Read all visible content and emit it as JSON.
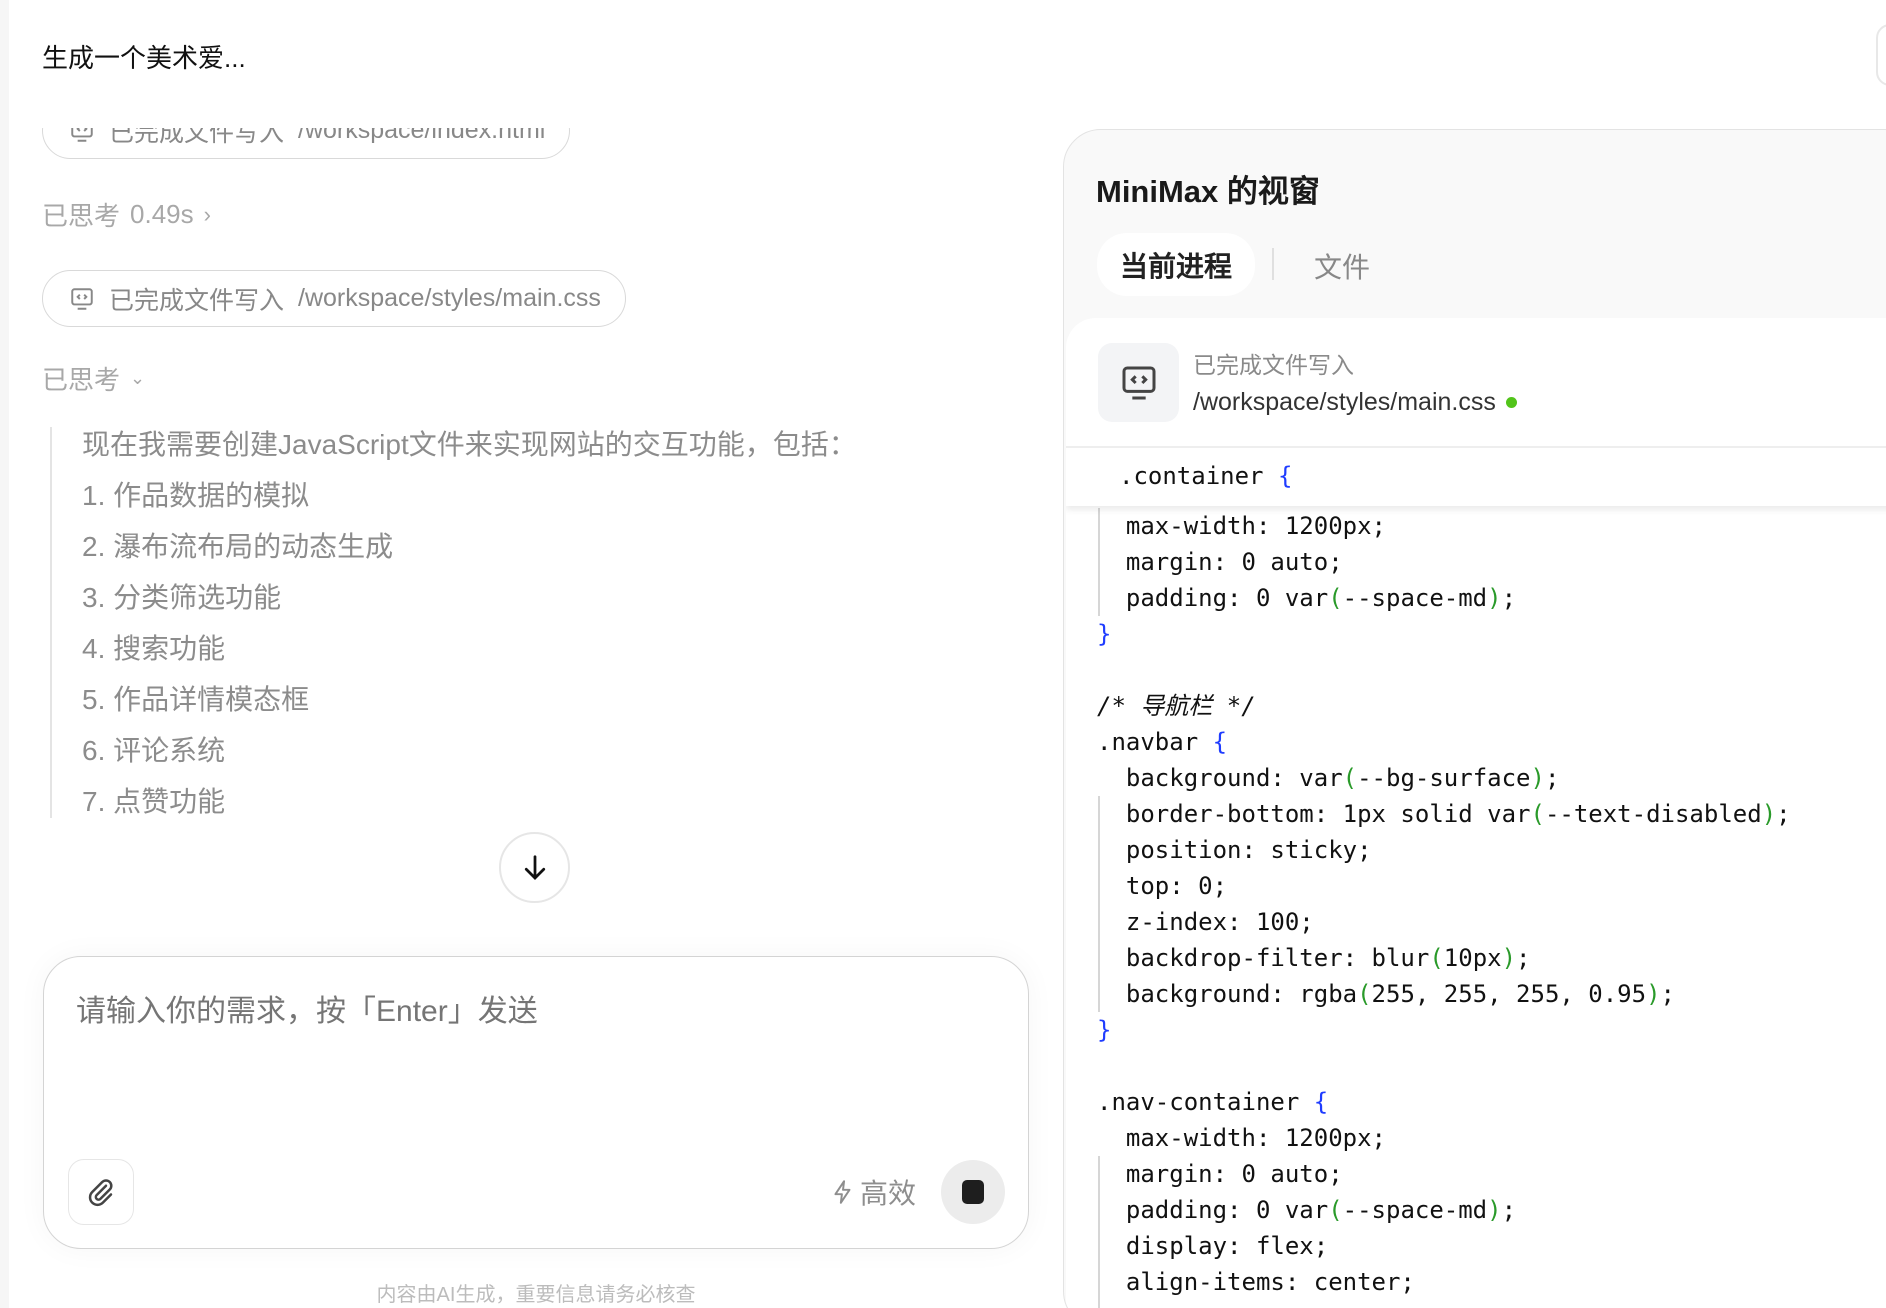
{
  "header": {
    "title": "生成一个美术爱..."
  },
  "chat": {
    "chip1": {
      "label": "已完成文件写入",
      "path": "/workspace/index.html"
    },
    "think1": {
      "label": "已思考",
      "time": "0.49s"
    },
    "chip2": {
      "label": "已完成文件写入",
      "path": "/workspace/styles/main.css"
    },
    "think2": {
      "label": "已思考"
    },
    "thought_lines": [
      "现在我需要创建JavaScript文件来实现网站的交互功能，包括：",
      "1. 作品数据的模拟",
      "2. 瀑布流布局的动态生成",
      "3. 分类筛选功能",
      "4. 搜索功能",
      "5. 作品详情模态框",
      "6. 评论系统",
      "7. 点赞功能"
    ]
  },
  "input": {
    "placeholder": "请输入你的需求，按「Enter」发送",
    "mode_label": "高效"
  },
  "footer": {
    "disclaimer": "内容由AI生成，重要信息请务必核查"
  },
  "panel": {
    "title": "MiniMax 的视窗",
    "tabs": [
      {
        "label": "当前进程",
        "active": true
      },
      {
        "label": "文件",
        "active": false
      }
    ],
    "file": {
      "status": "已完成文件写入",
      "path": "/workspace/styles/main.css",
      "status_color": "#52c41a"
    },
    "sticky_line": ".container {",
    "code_lines": [
      "  max-width: 1200px;",
      "  margin: 0 auto;",
      "  padding: 0 var(--space-md);",
      "}",
      "",
      "/* 导航栏 */",
      ".navbar {",
      "  background: var(--bg-surface);",
      "  border-bottom: 1px solid var(--text-disabled);",
      "  position: sticky;",
      "  top: 0;",
      "  z-index: 100;",
      "  backdrop-filter: blur(10px);",
      "  background: rgba(255, 255, 255, 0.95);",
      "}",
      "",
      ".nav-container {",
      "  max-width: 1200px;",
      "  margin: 0 auto;",
      "  padding: 0 var(--space-md);",
      "  display: flex;",
      "  align-items: center;"
    ]
  }
}
